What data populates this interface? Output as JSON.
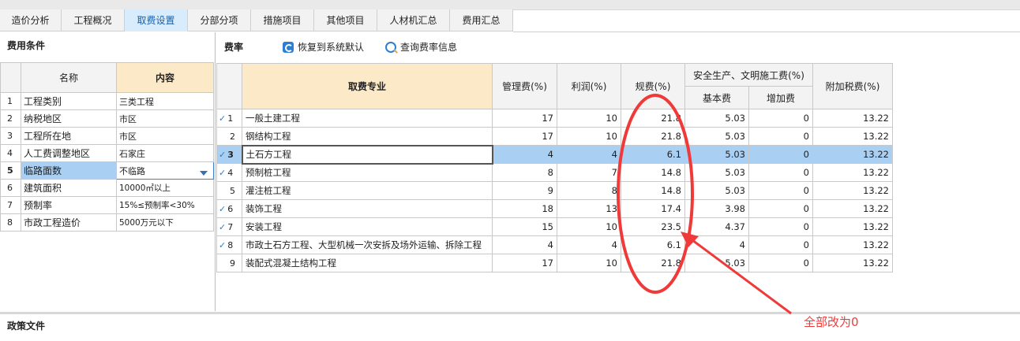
{
  "tabs": [
    "造价分析",
    "工程概况",
    "取费设置",
    "分部分项",
    "措施项目",
    "其他项目",
    "人材机汇总",
    "费用汇总"
  ],
  "active_tab": 2,
  "left_panel": {
    "title": "费用条件",
    "headers": {
      "name": "名称",
      "content": "内容"
    },
    "rows": [
      {
        "idx": "1",
        "name": "工程类别",
        "content": "三类工程"
      },
      {
        "idx": "2",
        "name": "纳税地区",
        "content": "市区"
      },
      {
        "idx": "3",
        "name": "工程所在地",
        "content": "市区"
      },
      {
        "idx": "4",
        "name": "人工费调整地区",
        "content": "石家庄"
      },
      {
        "idx": "5",
        "name": "临路面数",
        "content": "不临路"
      },
      {
        "idx": "6",
        "name": "建筑面积",
        "content": "10000㎡以上"
      },
      {
        "idx": "7",
        "name": "预制率",
        "content": "15%≤预制率<30%"
      },
      {
        "idx": "8",
        "name": "市政工程造价",
        "content": "5000万元以下"
      }
    ]
  },
  "right_panel": {
    "title": "费率",
    "restore_label": "恢复到系统默认",
    "query_label": "查询费率信息",
    "headers": {
      "major": "取费专业",
      "mgmt": "管理费(%)",
      "profit": "利润(%)",
      "fees": "规费(%)",
      "safety": "安全生产、文明施工费(%)",
      "base": "基本费",
      "extra": "增加费",
      "tax": "附加税费(%)"
    },
    "rows": [
      {
        "checked": true,
        "idx": "1",
        "name": "一般土建工程",
        "mgmt": "17",
        "profit": "10",
        "fees": "21.8",
        "base": "5.03",
        "extra": "0",
        "tax": "13.22"
      },
      {
        "checked": false,
        "idx": "2",
        "name": "钢结构工程",
        "mgmt": "17",
        "profit": "10",
        "fees": "21.8",
        "base": "5.03",
        "extra": "0",
        "tax": "13.22"
      },
      {
        "checked": true,
        "idx": "3",
        "name": "土石方工程",
        "mgmt": "4",
        "profit": "4",
        "fees": "6.1",
        "base": "5.03",
        "extra": "0",
        "tax": "13.22"
      },
      {
        "checked": true,
        "idx": "4",
        "name": "预制桩工程",
        "mgmt": "8",
        "profit": "7",
        "fees": "14.8",
        "base": "5.03",
        "extra": "0",
        "tax": "13.22"
      },
      {
        "checked": false,
        "idx": "5",
        "name": "灌注桩工程",
        "mgmt": "9",
        "profit": "8",
        "fees": "14.8",
        "base": "5.03",
        "extra": "0",
        "tax": "13.22"
      },
      {
        "checked": true,
        "idx": "6",
        "name": "装饰工程",
        "mgmt": "18",
        "profit": "13",
        "fees": "17.4",
        "base": "3.98",
        "extra": "0",
        "tax": "13.22"
      },
      {
        "checked": true,
        "idx": "7",
        "name": "安装工程",
        "mgmt": "15",
        "profit": "10",
        "fees": "23.5",
        "base": "4.37",
        "extra": "0",
        "tax": "13.22"
      },
      {
        "checked": true,
        "idx": "8",
        "name": "市政土石方工程、大型机械一次安拆及场外运输、拆除工程",
        "mgmt": "4",
        "profit": "4",
        "fees": "6.1",
        "base": "4",
        "extra": "0",
        "tax": "13.22"
      },
      {
        "checked": false,
        "idx": "9",
        "name": "装配式混凝土结构工程",
        "mgmt": "17",
        "profit": "10",
        "fees": "21.8",
        "base": "5.03",
        "extra": "0",
        "tax": "13.22"
      }
    ],
    "selected_row": 2
  },
  "bottom_panel": {
    "title": "政策文件"
  },
  "annotation": {
    "text": "全部改为0",
    "color": "#f03a3a"
  }
}
